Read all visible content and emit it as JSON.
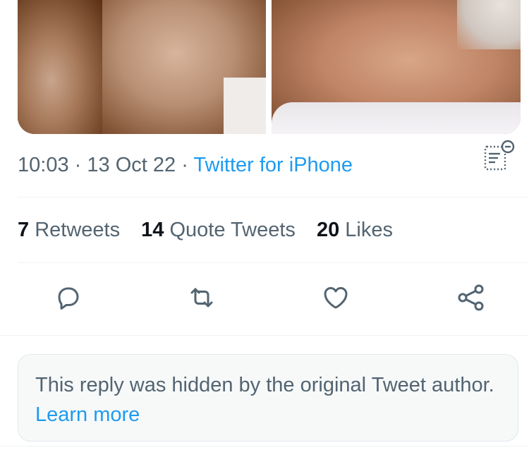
{
  "tweet": {
    "time": "10:03",
    "date": "13 Oct 22",
    "separator": "·",
    "source": "Twitter for iPhone",
    "media": [
      {
        "description_icon": "photo-hands"
      },
      {
        "description_icon": "photo-face"
      }
    ]
  },
  "stats": [
    {
      "count": "7",
      "label": "Retweets"
    },
    {
      "count": "14",
      "label": "Quote Tweets"
    },
    {
      "count": "20",
      "label": "Likes"
    }
  ],
  "actions": [
    {
      "icon": "reply-icon"
    },
    {
      "icon": "retweet-icon"
    },
    {
      "icon": "like-icon"
    },
    {
      "icon": "share-icon"
    }
  ],
  "hidden_reply": {
    "text": "This reply was hidden by the original Tweet author.",
    "link": "Learn more"
  },
  "colors": {
    "accent": "#1d9bf0",
    "text_secondary": "#536471",
    "text_primary": "#0f1419",
    "divider": "#eff3f4"
  }
}
